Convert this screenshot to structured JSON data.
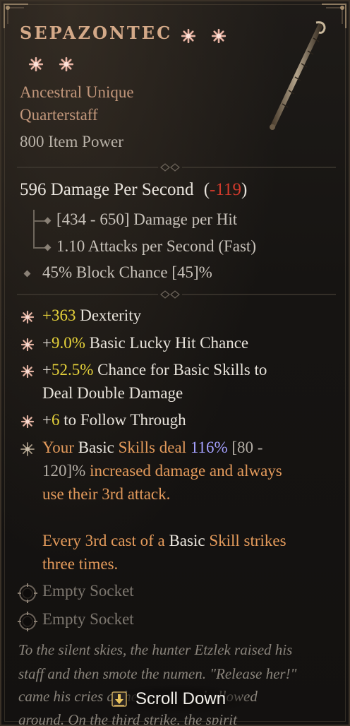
{
  "item": {
    "name": "SEPAZONTEC",
    "rarity_line": "Ancestral Unique",
    "type_line": "Quarterstaff",
    "item_power": "800 Item Power"
  },
  "dps": {
    "value_text": "596 Damage Per Second",
    "open_paren": "(",
    "delta": "-119",
    "close_paren": ")"
  },
  "base_stats": [
    "[434 - 650] Damage per Hit",
    "1.10 Attacks per Second (Fast)"
  ],
  "implicit": {
    "value": "45%",
    "label": "Block Chance [45]%"
  },
  "affixes": [
    {
      "value": "+363",
      "label": "Dexterity"
    },
    {
      "prefix": "+",
      "value": "9.0%",
      "label": "Basic Lucky Hit Chance"
    },
    {
      "prefix": "+",
      "value": "52.5%",
      "label": "Chance for Basic Skills to",
      "label2": "Deal Double Damage"
    },
    {
      "prefix": "+",
      "value": "6",
      "label": "to Follow Through"
    }
  ],
  "aspect": {
    "line1_a": "Your ",
    "line1_b": "Basic",
    "line1_c": " Skills deal ",
    "line1_d": "116%",
    "line1_e": " [80 -",
    "line2_a": "120]%",
    "line2_b": " increased damage and always",
    "line3": "use their 3rd attack.",
    "line4_a": "Every 3rd cast of a ",
    "line4_b": "Basic",
    "line4_c": " Skill strikes",
    "line5": "three times."
  },
  "sockets": [
    "Empty Socket",
    "Empty Socket"
  ],
  "flavor": [
    "To the silent skies, the hunter Etzlek raised his",
    "staff and then smote the numen. \"Release her!\"",
    "came his cries as he struck the hallowed",
    "ground. On the third strike, the spirit"
  ],
  "scroll": {
    "label": "Scroll Down"
  },
  "colors": {
    "title": "#d4a988",
    "unique_text": "#c2977b",
    "affix_value": "#e7d33a",
    "aspect": "#e39a5b",
    "penalty": "#d13a2c",
    "aspect_value": "#a4a0ff"
  },
  "icons": {
    "rank_pips": "snowflake-pip-icon",
    "affix_bullet": "snowflake-bullet-icon",
    "aspect_bullet": "star-bullet-icon",
    "socket": "socket-icon",
    "scroll": "scroll-down-icon",
    "item_art": "quarterstaff-icon"
  }
}
